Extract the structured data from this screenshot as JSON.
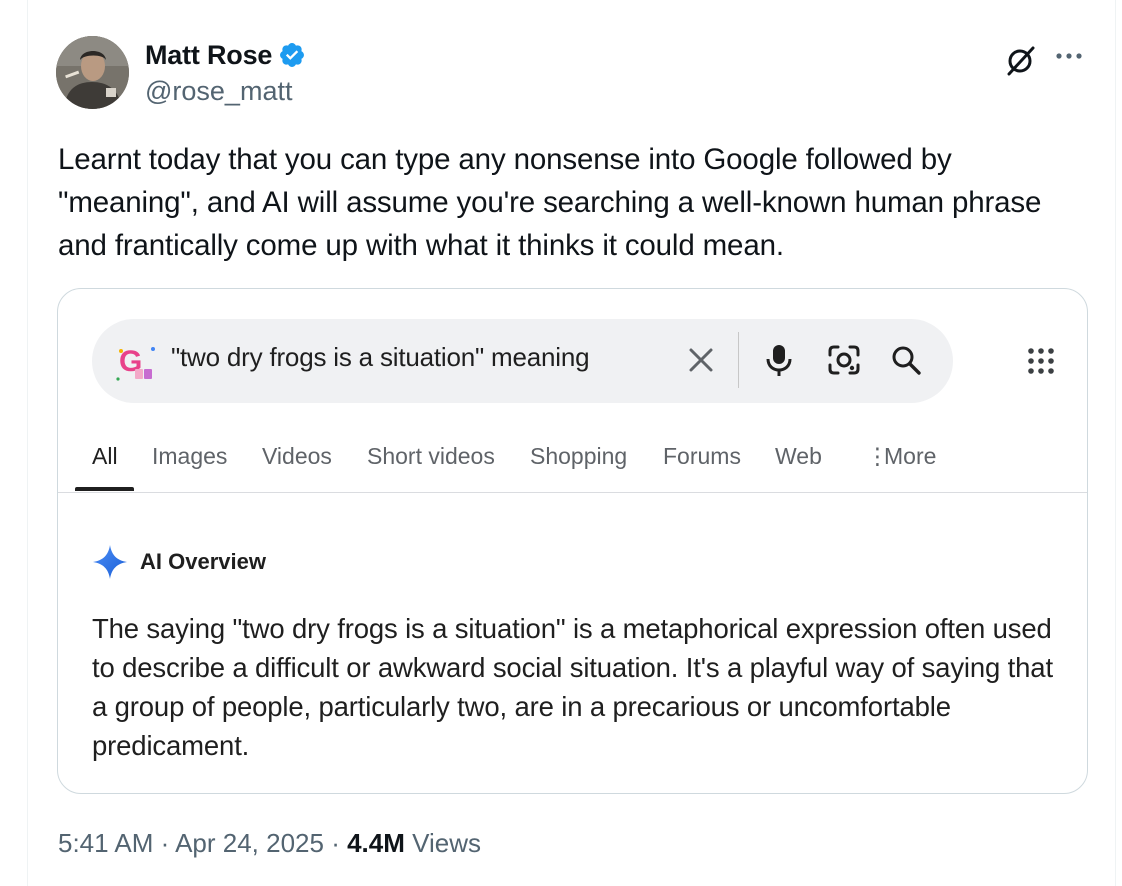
{
  "tweet": {
    "author": {
      "display_name": "Matt Rose",
      "handle": "@rose_matt",
      "verified": true,
      "verified_color": "#1d9bf0"
    },
    "text": "Learnt today that you can type any nonsense into Google followed by \"meaning\", and AI will assume you're searching a well-known human phrase and frantically come up with what it thinks it could mean.",
    "header_icons": [
      "grok-icon",
      "more-horizontal-icon"
    ],
    "meta": {
      "time": "5:41 AM",
      "separator": " · ",
      "date": "Apr 24, 2025",
      "views_count": "4.4M",
      "views_label": "Views"
    }
  },
  "google_card": {
    "search": {
      "query": "\"two dry frogs is a situation\" meaning",
      "icons": [
        "google-doodle-icon",
        "clear-icon",
        "mic-icon",
        "lens-icon",
        "search-icon",
        "apps-grid-icon"
      ]
    },
    "tabs": [
      {
        "label": "All",
        "active": true
      },
      {
        "label": "Images",
        "active": false
      },
      {
        "label": "Videos",
        "active": false
      },
      {
        "label": "Short videos",
        "active": false
      },
      {
        "label": "Shopping",
        "active": false
      },
      {
        "label": "Forums",
        "active": false
      },
      {
        "label": "Web",
        "active": false
      },
      {
        "label": "More",
        "active": false
      }
    ],
    "ai_overview": {
      "title": "AI Overview",
      "icon": "gemini-sparkle-icon",
      "body": "The saying \"two dry frogs is a situation\" is a metaphorical expression often used to describe a difficult or awkward social situation. It's a playful way of saying that a group of people, particularly two, are in a precarious or uncomfortable predicament."
    }
  }
}
